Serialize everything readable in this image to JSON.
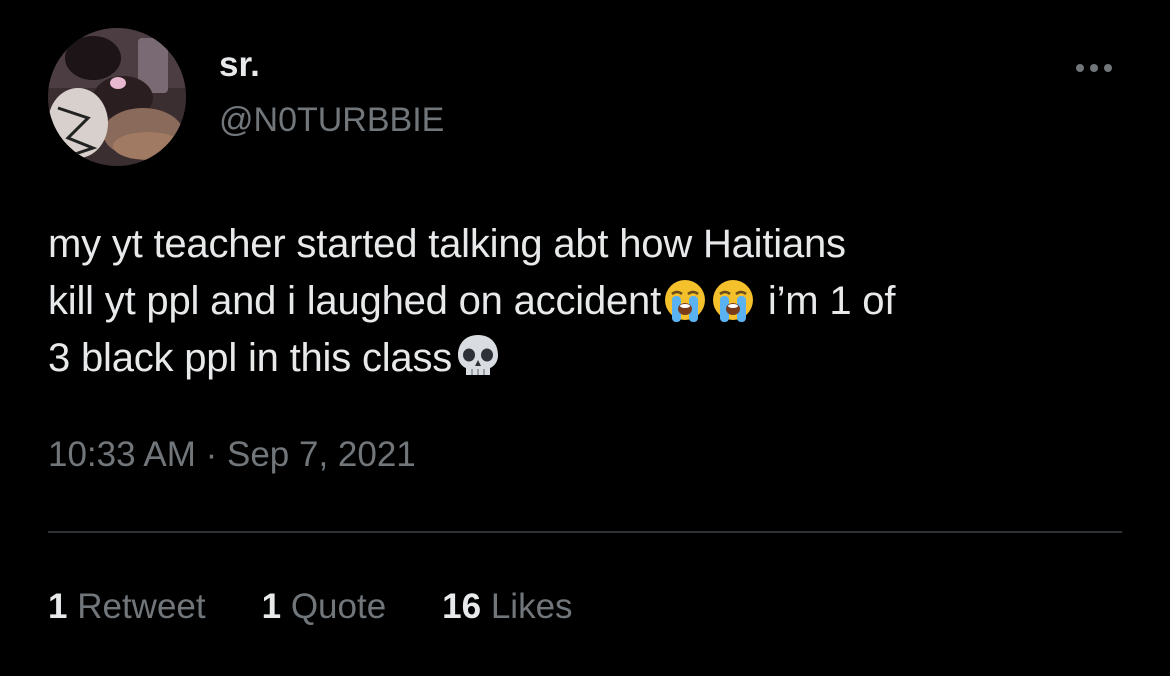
{
  "author": {
    "display_name": "sr.",
    "handle": "@N0TURBBIE"
  },
  "tweet": {
    "lines": [
      [
        "my yt teacher started talking abt how Haitians"
      ],
      [
        "kill yt ppl and i laughed on accident",
        "crying-face-emoji",
        "crying-face-emoji",
        " i’m 1 of"
      ],
      [
        "3 black ppl in this class",
        "skull-emoji"
      ]
    ],
    "line1": "my yt teacher started talking abt how Haitians",
    "line2_text": "kill yt ppl and i laughed on accident",
    "line2_tail": " i’m 1 of",
    "line3_text": "3 black ppl in this class",
    "time": "10:33 AM",
    "separator": " · ",
    "date": "Sep 7, 2021"
  },
  "stats": {
    "retweets_count": "1",
    "retweets_label": "Retweet",
    "quotes_count": "1",
    "quotes_label": "Quote",
    "likes_count": "16",
    "likes_label": "Likes"
  },
  "icons": {
    "more": "more-horizontal-icon",
    "crying": "loudly-crying-face-emoji",
    "skull": "skull-emoji"
  },
  "colors": {
    "background": "#000000",
    "primary_text": "#e7e9ea",
    "secondary_text": "#71767b",
    "divider": "#2f3336"
  }
}
